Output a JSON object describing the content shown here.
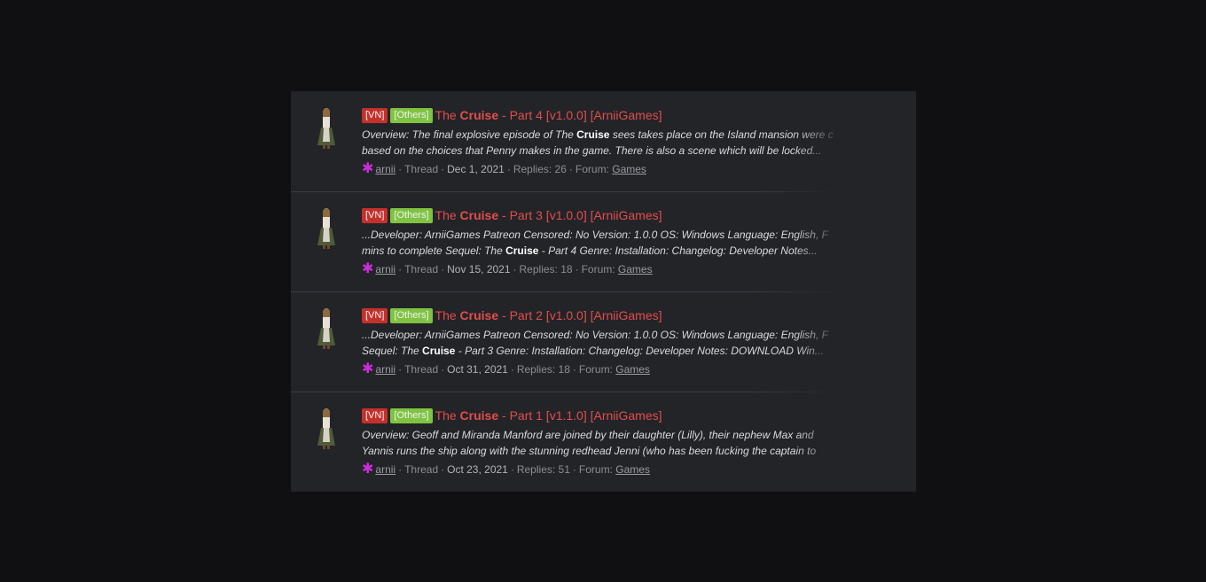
{
  "results": [
    {
      "tags": [
        "[VN]",
        "[Others]"
      ],
      "title_pre": "The ",
      "title_hl": "Cruise",
      "title_post": " - Part 4 [v1.0.0] [ArniiGames]",
      "snippet1_pre": "Overview: The final explosive episode of The ",
      "snippet1_hl": "Cruise",
      "snippet1_post": " sees takes place on the Island mansion were c",
      "snippet2_pre": "based on the choices that Penny makes in the game. There is also a scene which will be locked...",
      "snippet2_hl": "",
      "snippet2_post": "",
      "author": "arnii",
      "type": "Thread",
      "date": "Dec 1, 2021",
      "replies": "Replies: 26",
      "forum_label": "Forum:",
      "forum": "Games"
    },
    {
      "tags": [
        "[VN]",
        "[Others]"
      ],
      "title_pre": "The ",
      "title_hl": "Cruise",
      "title_post": " - Part 3 [v1.0.0] [ArniiGames]",
      "snippet1_pre": "...Developer: ArniiGames Patreon Censored: No Version: 1.0.0 OS: Windows Language: English, F",
      "snippet1_hl": "",
      "snippet1_post": "",
      "snippet2_pre": "mins to complete Sequel: The ",
      "snippet2_hl": "Cruise",
      "snippet2_post": " - Part 4 Genre: Installation: Changelog: Developer Notes...",
      "author": "arnii",
      "type": "Thread",
      "date": "Nov 15, 2021",
      "replies": "Replies: 18",
      "forum_label": "Forum:",
      "forum": "Games"
    },
    {
      "tags": [
        "[VN]",
        "[Others]"
      ],
      "title_pre": "The ",
      "title_hl": "Cruise",
      "title_post": " - Part 2 [v1.0.0] [ArniiGames]",
      "snippet1_pre": "...Developer: ArniiGames Patreon Censored: No Version: 1.0.0 OS: Windows Language: English, F",
      "snippet1_hl": "",
      "snippet1_post": "",
      "snippet2_pre": "Sequel: The ",
      "snippet2_hl": "Cruise",
      "snippet2_post": " - Part 3 Genre: Installation: Changelog: Developer Notes: DOWNLOAD Win...",
      "author": "arnii",
      "type": "Thread",
      "date": "Oct 31, 2021",
      "replies": "Replies: 18",
      "forum_label": "Forum:",
      "forum": "Games"
    },
    {
      "tags": [
        "[VN]",
        "[Others]"
      ],
      "title_pre": "The ",
      "title_hl": "Cruise",
      "title_post": " - Part 1 [v1.1.0] [ArniiGames]",
      "snippet1_pre": "Overview: Geoff and Miranda Manford are joined by their daughter (Lilly), their nephew Max and",
      "snippet1_hl": "",
      "snippet1_post": "",
      "snippet2_pre": "Yannis runs the ship along with the stunning redhead Jenni (who has been fucking the captain to",
      "snippet2_hl": "",
      "snippet2_post": "",
      "author": "arnii",
      "type": "Thread",
      "date": "Oct 23, 2021",
      "replies": "Replies: 51",
      "forum_label": "Forum:",
      "forum": "Games"
    }
  ],
  "icons": {
    "author_marker": "asterisk-icon",
    "avatar": "character-avatar"
  },
  "colors": {
    "background": "#101012",
    "panel": "#232428",
    "title": "#e24d4d",
    "tag_vn": "#c4302b",
    "tag_others": "#7fc341",
    "author_marker": "#cc2ddb"
  }
}
